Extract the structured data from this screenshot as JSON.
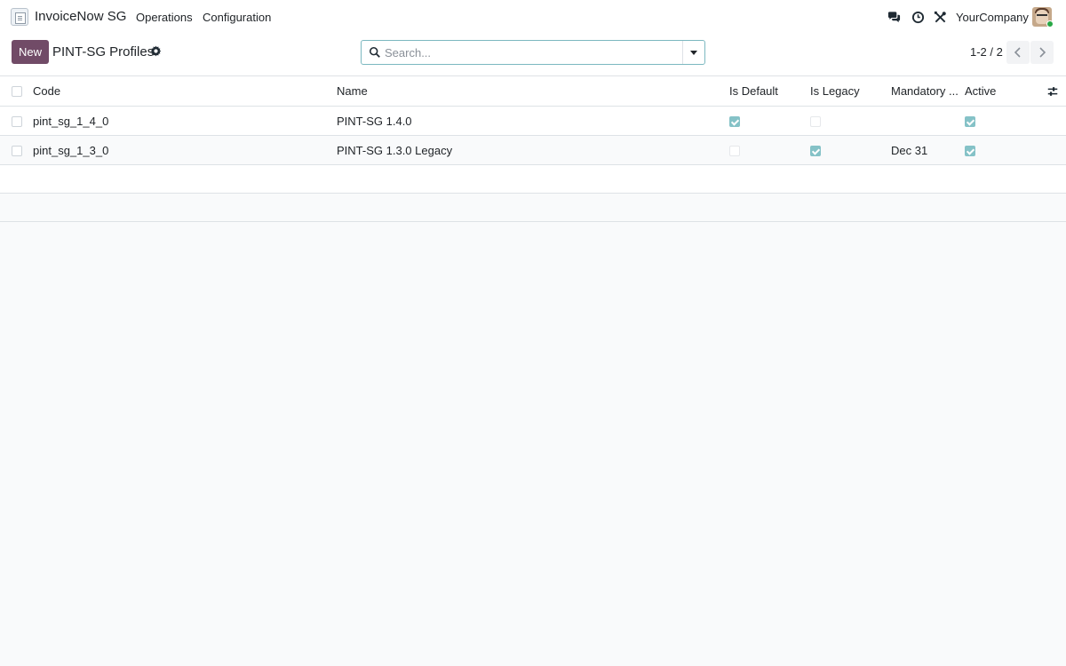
{
  "navbar": {
    "app_icon": "invoice-app-icon",
    "brand": "InvoiceNow SG",
    "menu": [
      "Operations",
      "Configuration"
    ],
    "systray": {
      "icons": [
        "messages-icon",
        "activity-clock-icon",
        "debug-tools-icon"
      ],
      "company": "YourCompany",
      "avatar": "user-avatar"
    }
  },
  "control_panel": {
    "new_label": "New",
    "title": "PINT-SG Profiles",
    "gear_icon": "gear-icon",
    "search": {
      "placeholder": "Search...",
      "value": ""
    },
    "pager": "1-2 / 2"
  },
  "list": {
    "columns": [
      "Code",
      "Name",
      "Is Default",
      "Is Legacy",
      "Mandatory ...",
      "Active"
    ],
    "rows": [
      {
        "code": "pint_sg_1_4_0",
        "name": "PINT-SG 1.4.0",
        "is_default": true,
        "is_legacy": false,
        "mandatory": "",
        "active": true
      },
      {
        "code": "pint_sg_1_3_0",
        "name": "PINT-SG 1.3.0 Legacy",
        "is_default": false,
        "is_legacy": true,
        "mandatory": "Dec 31",
        "active": true
      }
    ]
  },
  "colors": {
    "primary": "#714b67",
    "check": "#71b7bd",
    "background": "#f9fafb"
  }
}
